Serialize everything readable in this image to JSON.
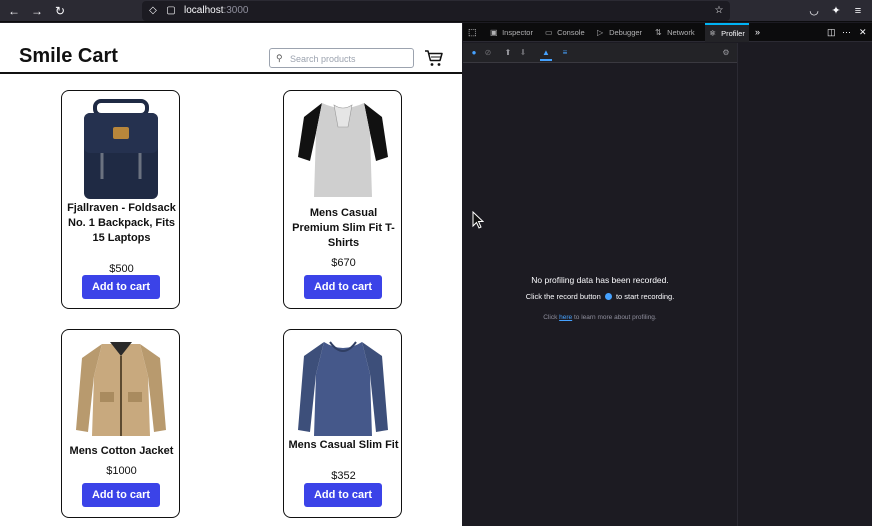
{
  "browser": {
    "url_host": "localhost",
    "url_port": ":3000"
  },
  "app": {
    "brand": "Smile Cart",
    "search_placeholder": "Search products"
  },
  "products": [
    {
      "name": "Fjallraven - Foldsack No. 1 Backpack, Fits 15 Laptops",
      "price": "$500",
      "button": "Add to cart"
    },
    {
      "name": "Mens Casual Premium Slim Fit T-Shirts",
      "price": "$670",
      "button": "Add to cart"
    },
    {
      "name": "Mens Cotton Jacket",
      "price": "$1000",
      "button": "Add to cart"
    },
    {
      "name": "Mens Casual Slim Fit",
      "price": "$352",
      "button": "Add to cart"
    }
  ],
  "devtools": {
    "tabs": [
      "Inspector",
      "Console",
      "Debugger",
      "Network",
      "Profiler"
    ],
    "active_tab": "Profiler",
    "empty_title": "No profiling data has been recorded.",
    "empty_hint_before": "Click the record button",
    "empty_hint_after": "to start recording.",
    "learn_before": "Click",
    "learn_link": "here",
    "learn_after": "to learn more about profiling."
  },
  "colors": {
    "accent_button": "#3b43e8",
    "devtools_bg": "#1c1b22",
    "active_tab_line": "#00b3f4"
  }
}
